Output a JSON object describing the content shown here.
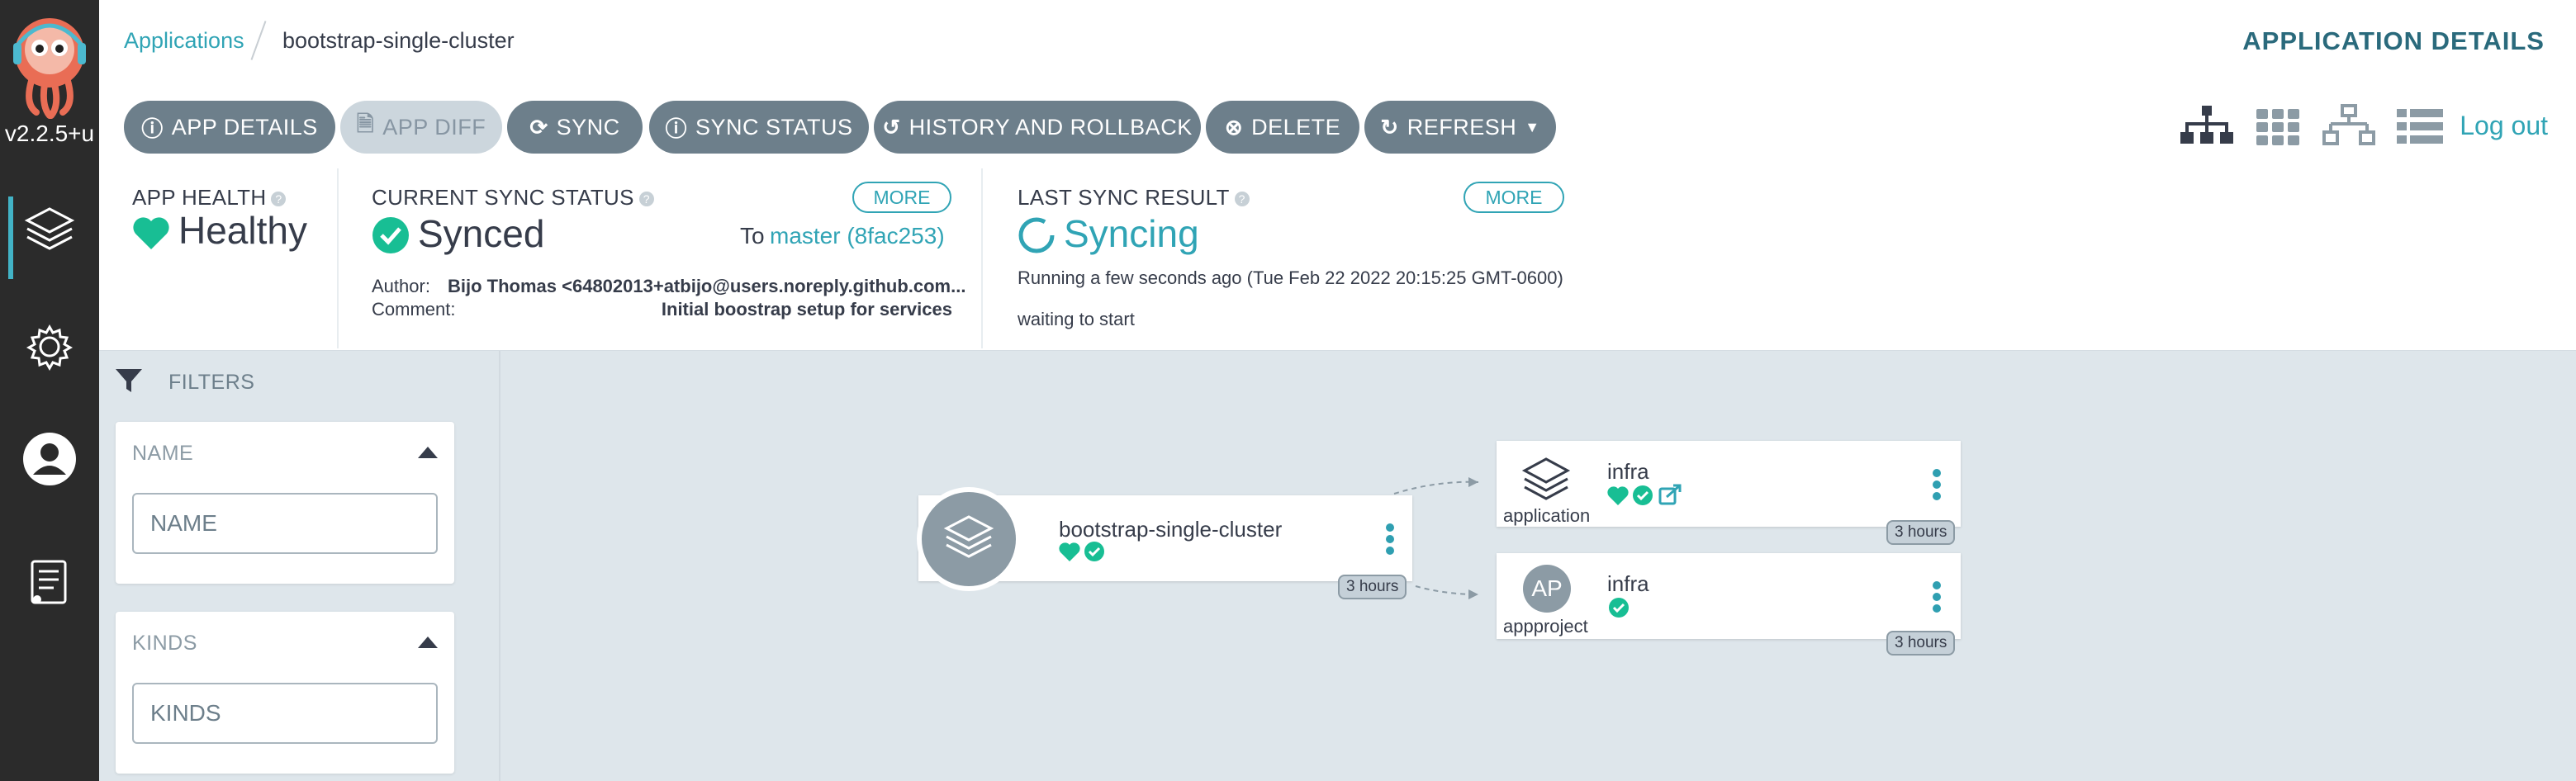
{
  "nav": {
    "version": "v2.2.5+u",
    "items": [
      "applications-icon",
      "settings-icon",
      "user-icon",
      "docs-icon"
    ]
  },
  "breadcrumb": {
    "applications": "Applications",
    "current": "bootstrap-single-cluster"
  },
  "header": {
    "title": "APPLICATION DETAILS",
    "logout": "Log out"
  },
  "toolbar": {
    "app_details": "APP DETAILS",
    "app_diff": "APP DIFF",
    "sync": "SYNC",
    "sync_status": "SYNC STATUS",
    "history": "HISTORY AND ROLLBACK",
    "delete": "DELETE",
    "refresh": "REFRESH"
  },
  "status": {
    "health_label": "APP HEALTH",
    "health_value": "Healthy",
    "sync_label": "CURRENT SYNC STATUS",
    "sync_value": "Synced",
    "more": "MORE",
    "to_prefix": "To",
    "to_revision": "master (8fac253)",
    "author_label": "Author:",
    "author_value": "Bijo Thomas <64802013+atbijo@users.noreply.github.com...",
    "comment_label": "Comment:",
    "comment_value": "Initial boostrap setup for services",
    "last_sync_label": "LAST SYNC RESULT",
    "last_sync_value": "Syncing",
    "running": "Running a few seconds ago (Tue Feb 22 2022 20:15:25 GMT-0600)",
    "waiting": "waiting to start"
  },
  "filters": {
    "title": "FILTERS",
    "name_label": "NAME",
    "name_placeholder": "NAME",
    "kinds_label": "KINDS",
    "kinds_placeholder": "KINDS"
  },
  "graph": {
    "root": {
      "name": "bootstrap-single-cluster",
      "age": "3 hours"
    },
    "children": [
      {
        "name": "infra",
        "kind": "application",
        "age": "3 hours"
      },
      {
        "name": "infra",
        "kind": "appproject",
        "initials": "AP",
        "age": "3 hours"
      }
    ]
  },
  "colors": {
    "accent": "#30a4b5",
    "healthy": "#18be94",
    "button": "#6d7f8b",
    "sidebar": "#2b2b2b"
  }
}
